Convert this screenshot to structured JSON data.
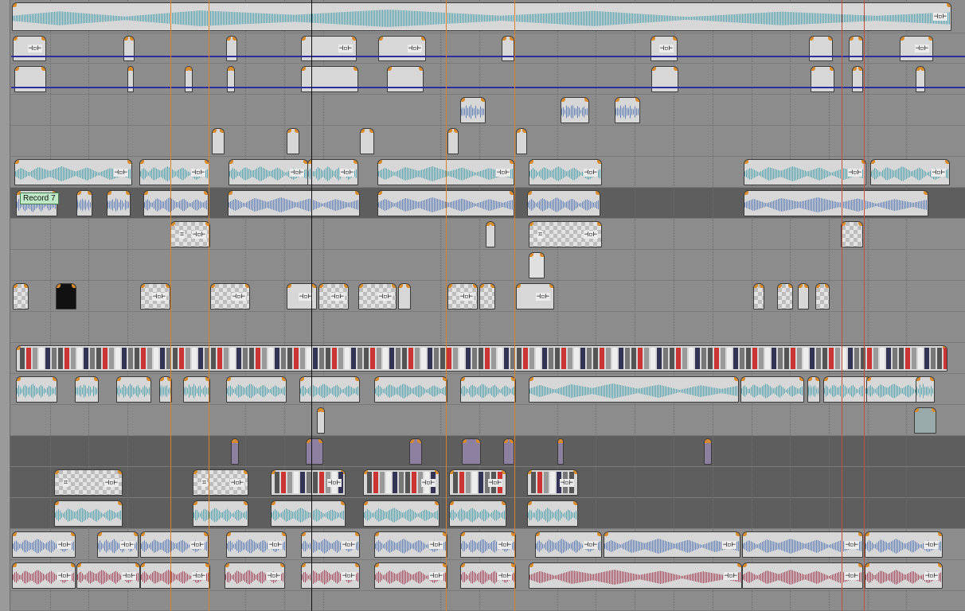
{
  "window": {
    "title": ""
  },
  "region_label": "Record 7",
  "colors": {
    "track_bg": "#8c8c8c",
    "dark_track_bg": "#5e5e5e",
    "event_bg": "#d7d7d7",
    "teal_wave": "#3e9aa7",
    "blue_wave": "#4a6fb0",
    "red_wave": "#9a2f45",
    "envelope": "#2e2e9a",
    "cursor": "#111111",
    "loop_marker": "#d9812b"
  },
  "icons": {
    "fx": "event-fx-icon",
    "crop": "pan-crop-icon",
    "fade": "fade-handle-icon"
  },
  "event_fx_glyph": "⊣▫⊢",
  "crop_glyph": "⌗"
}
